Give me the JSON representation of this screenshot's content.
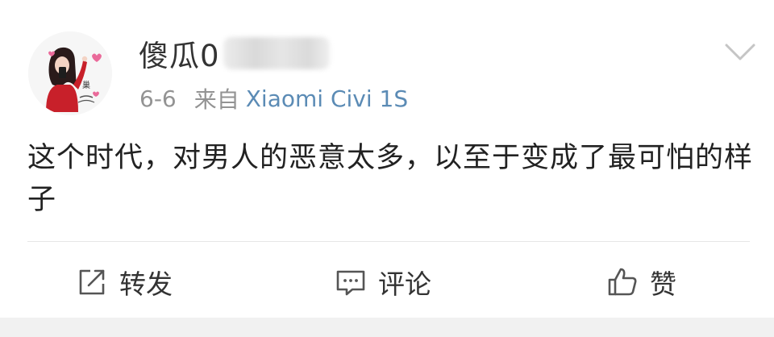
{
  "post": {
    "author": {
      "name": "傻瓜0",
      "avatar_icon": "avatar-illustration-icon"
    },
    "meta": {
      "time": "6-6",
      "from_label": "来自",
      "source": "Xiaomi Civi 1S"
    },
    "text": "这个时代，对男人的恶意太多，以至于变成了最可怕的样子",
    "menu_icon": "chevron-down-icon"
  },
  "actions": {
    "repost": {
      "label": "转发",
      "icon": "share-icon"
    },
    "comment": {
      "label": "评论",
      "icon": "comment-icon"
    },
    "like": {
      "label": "赞",
      "icon": "thumbs-up-icon"
    }
  },
  "colors": {
    "text": "#333333",
    "meta": "#939393",
    "source_link": "#5b8bb5",
    "divider": "#e6e6e6",
    "footer_bg": "#f1f1f1"
  }
}
